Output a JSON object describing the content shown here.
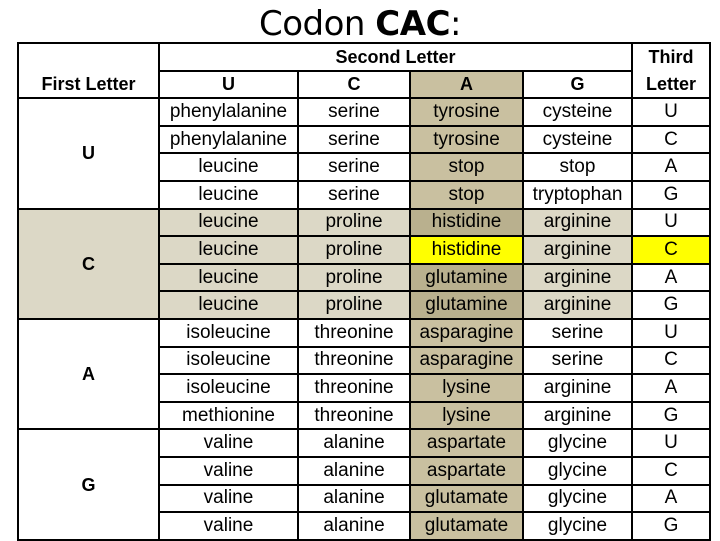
{
  "title": {
    "prefix": "Codon ",
    "codon": "CAC",
    "suffix": ":"
  },
  "header": {
    "first_letter": "First Letter",
    "second_letter": "Second Letter",
    "third_letter_line1": "Third",
    "third_letter_line2": "Letter",
    "second_letters": [
      "U",
      "C",
      "A",
      "G"
    ]
  },
  "colors": {
    "group_c_bg": "#dcd8c6",
    "column_a_bg": "#c9c0a0",
    "highlight": "#ffff00"
  },
  "highlighted": {
    "first": "C",
    "second": "A",
    "third": "C",
    "amino_acid": "histidine"
  },
  "groups": [
    {
      "first": "U",
      "rows": [
        {
          "cells": [
            "phenylalanine",
            "serine",
            "tyrosine",
            "cysteine"
          ],
          "third": "U"
        },
        {
          "cells": [
            "phenylalanine",
            "serine",
            "tyrosine",
            "cysteine"
          ],
          "third": "C"
        },
        {
          "cells": [
            "leucine",
            "serine",
            "stop",
            "stop"
          ],
          "third": "A"
        },
        {
          "cells": [
            "leucine",
            "serine",
            "stop",
            "tryptophan"
          ],
          "third": "G"
        }
      ]
    },
    {
      "first": "C",
      "rows": [
        {
          "cells": [
            "leucine",
            "proline",
            "histidine",
            "arginine"
          ],
          "third": "U"
        },
        {
          "cells": [
            "leucine",
            "proline",
            "histidine",
            "arginine"
          ],
          "third": "C"
        },
        {
          "cells": [
            "leucine",
            "proline",
            "glutamine",
            "arginine"
          ],
          "third": "A"
        },
        {
          "cells": [
            "leucine",
            "proline",
            "glutamine",
            "arginine"
          ],
          "third": "G"
        }
      ]
    },
    {
      "first": "A",
      "rows": [
        {
          "cells": [
            "isoleucine",
            "threonine",
            "asparagine",
            "serine"
          ],
          "third": "U"
        },
        {
          "cells": [
            "isoleucine",
            "threonine",
            "asparagine",
            "serine"
          ],
          "third": "C"
        },
        {
          "cells": [
            "isoleucine",
            "threonine",
            "lysine",
            "arginine"
          ],
          "third": "A"
        },
        {
          "cells": [
            "methionine",
            "threonine",
            "lysine",
            "arginine"
          ],
          "third": "G"
        }
      ]
    },
    {
      "first": "G",
      "rows": [
        {
          "cells": [
            "valine",
            "alanine",
            "aspartate",
            "glycine"
          ],
          "third": "U"
        },
        {
          "cells": [
            "valine",
            "alanine",
            "aspartate",
            "glycine"
          ],
          "third": "C"
        },
        {
          "cells": [
            "valine",
            "alanine",
            "glutamate",
            "glycine"
          ],
          "third": "A"
        },
        {
          "cells": [
            "valine",
            "alanine",
            "glutamate",
            "glycine"
          ],
          "third": "G"
        }
      ]
    }
  ]
}
